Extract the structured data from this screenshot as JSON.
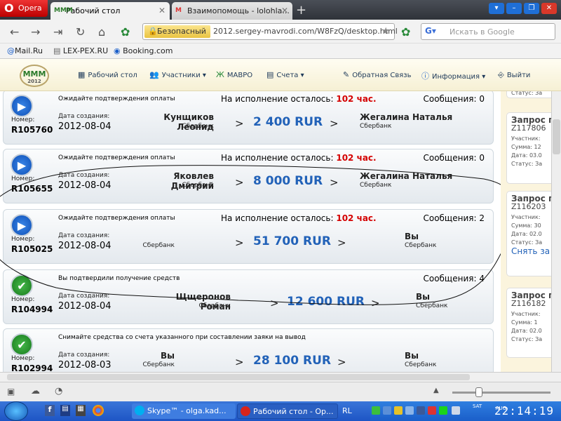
{
  "browser": {
    "menu_button": "Opera",
    "tabs": [
      {
        "label": "Рабочий стол",
        "favicon": "MMM"
      },
      {
        "label": "Взаимопомощь - lolohla...",
        "favicon": "M"
      }
    ],
    "security_label": "Безопасный",
    "url": "2012.sergey-mavrodi.com/W8FzQ/desktop.html",
    "search_placeholder": "Искать в Google",
    "bookmarks": [
      "Mail.Ru",
      "LEX-PEX.RU",
      "Booking.com"
    ]
  },
  "site": {
    "logo_text": "MMM",
    "logo_year": "2012",
    "menu": [
      "Рабочий стол",
      "Участники",
      "МАВРО",
      "Счета",
      "Обратная Связь",
      "Информация",
      "Выйти"
    ]
  },
  "labels": {
    "number": "Номер:",
    "created": "Дата создания:",
    "remaining": "На исполнение осталось:",
    "messages": "Сообщения:",
    "arrow": ">"
  },
  "orders": [
    {
      "status": "Ожидайте подтверждения оплаты",
      "status_icon": "play-icon",
      "remaining": "102 час.",
      "messages": "0",
      "number": "R105760",
      "date": "2012-08-04",
      "sender": "Кунщиков Леонид",
      "sender_bank": "Сбербанк",
      "amount": "2 400 RUR",
      "receiver": "Жегалина Наталья",
      "receiver_bank": "Сбербанк"
    },
    {
      "status": "Ожидайте подтверждения оплаты",
      "status_icon": "play-icon",
      "remaining": "102 час.",
      "messages": "0",
      "number": "R105655",
      "date": "2012-08-04",
      "sender": "Яковлев Дмитрий",
      "sender_bank": "Сбербанк",
      "amount": "8 000 RUR",
      "receiver": "Жегалина Наталья",
      "receiver_bank": "Сбербанк"
    },
    {
      "status": "Ожидайте подтверждения оплаты",
      "status_icon": "play-icon",
      "remaining": "102 час.",
      "messages": "2",
      "number": "R105025",
      "date": "2012-08-04",
      "sender": "",
      "sender_bank": "Сбербанк",
      "amount": "51 700 RUR",
      "receiver": "Вы",
      "receiver_bank": "Сбербанк"
    },
    {
      "status": "Вы подтвердили получение средств",
      "status_icon": "check-icon",
      "remaining": "",
      "messages": "4",
      "number": "R104994",
      "date": "2012-08-04",
      "sender": "Щщеронов Роман",
      "sender_bank": "Сбербанк",
      "amount": "12 600 RUR",
      "receiver": "Вы",
      "receiver_bank": "Сбербанк"
    },
    {
      "status": "Снимайте средства со счета указанного при составлении заяки на вывод",
      "status_icon": "check-icon",
      "remaining": "",
      "messages": "",
      "number": "R102994",
      "date": "2012-08-03",
      "sender": "Вы",
      "sender_bank": "Сбербанк",
      "amount": "28 100 RUR",
      "receiver": "Вы",
      "receiver_bank": "Сбербанк"
    }
  ],
  "requests": {
    "top_fragment": "Статус: За",
    "items": [
      {
        "title": "Запрос п",
        "id": "Z117806",
        "participant": "Участник:",
        "sum": "Сумма: 12",
        "date": "Дата: 03.0",
        "status": "Статус: За",
        "link": ""
      },
      {
        "title": "Запрос п",
        "id": "Z116203",
        "participant": "Участник:",
        "sum": "Сумма: 30",
        "date": "Дата: 02.0",
        "status": "Статус: За",
        "link": "Снять за"
      },
      {
        "title": "Запрос п",
        "id": "Z116182",
        "participant": "Участник:",
        "sum": "Сумма: 1",
        "date": "Дата: 02.0",
        "status": "Статус: За",
        "link": ""
      }
    ]
  },
  "taskbar": {
    "tasks": [
      "Skype™ - olga.kad...",
      "Рабочий стол - Ор..."
    ],
    "lang": "RL",
    "day": "AUG",
    "weekday": "SAT",
    "clock": "22:14:19"
  },
  "colors": {
    "accent": "#2262b8",
    "remaining": "#d40000",
    "taskbar": "#245edb"
  }
}
